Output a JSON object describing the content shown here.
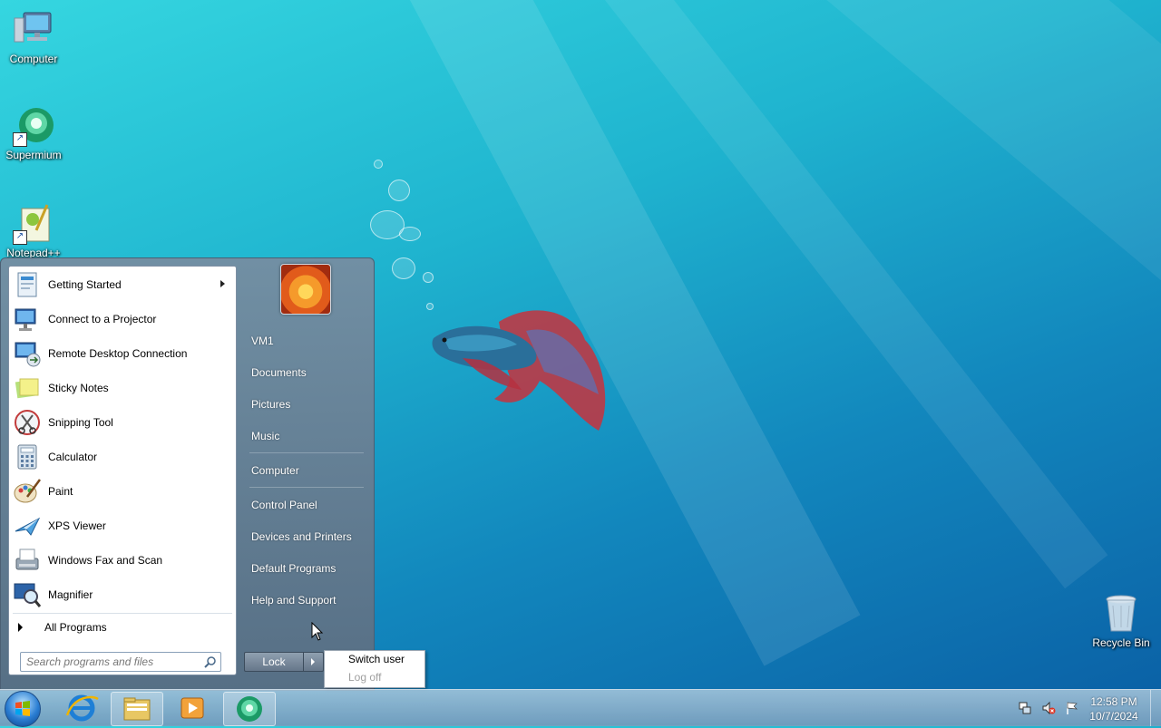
{
  "desktop": {
    "icons": [
      {
        "label": "Computer"
      },
      {
        "label": "Supermium"
      },
      {
        "label": "Notepad++"
      },
      {
        "label": "Recycle Bin"
      }
    ]
  },
  "start_menu": {
    "programs": [
      {
        "label": "Getting Started",
        "icon": "getting-started-icon",
        "has_submenu": true
      },
      {
        "label": "Connect to a Projector",
        "icon": "projector-icon"
      },
      {
        "label": "Remote Desktop Connection",
        "icon": "remote-desktop-icon"
      },
      {
        "label": "Sticky Notes",
        "icon": "sticky-notes-icon"
      },
      {
        "label": "Snipping Tool",
        "icon": "snipping-tool-icon"
      },
      {
        "label": "Calculator",
        "icon": "calculator-icon"
      },
      {
        "label": "Paint",
        "icon": "paint-icon"
      },
      {
        "label": "XPS Viewer",
        "icon": "xps-viewer-icon"
      },
      {
        "label": "Windows Fax and Scan",
        "icon": "fax-scan-icon"
      },
      {
        "label": "Magnifier",
        "icon": "magnifier-icon"
      }
    ],
    "all_programs": "All Programs",
    "search_placeholder": "Search programs and files",
    "right_items": {
      "user": "VM1",
      "documents": "Documents",
      "pictures": "Pictures",
      "music": "Music",
      "computer": "Computer",
      "control_panel": "Control Panel",
      "devices": "Devices and Printers",
      "default_programs": "Default Programs",
      "help": "Help and Support"
    },
    "power_button": "Lock",
    "power_menu": {
      "switch_user": "Switch user",
      "log_off": "Log off"
    }
  },
  "taskbar": {
    "clock_time": "12:58 PM",
    "clock_date": "10/7/2024",
    "pinned": [
      "internet-explorer-icon",
      "file-explorer-icon",
      "media-player-icon",
      "supermium-icon"
    ]
  },
  "colors": {
    "accent": "#1e6fb8",
    "taskbar": "#8fb4cf"
  }
}
